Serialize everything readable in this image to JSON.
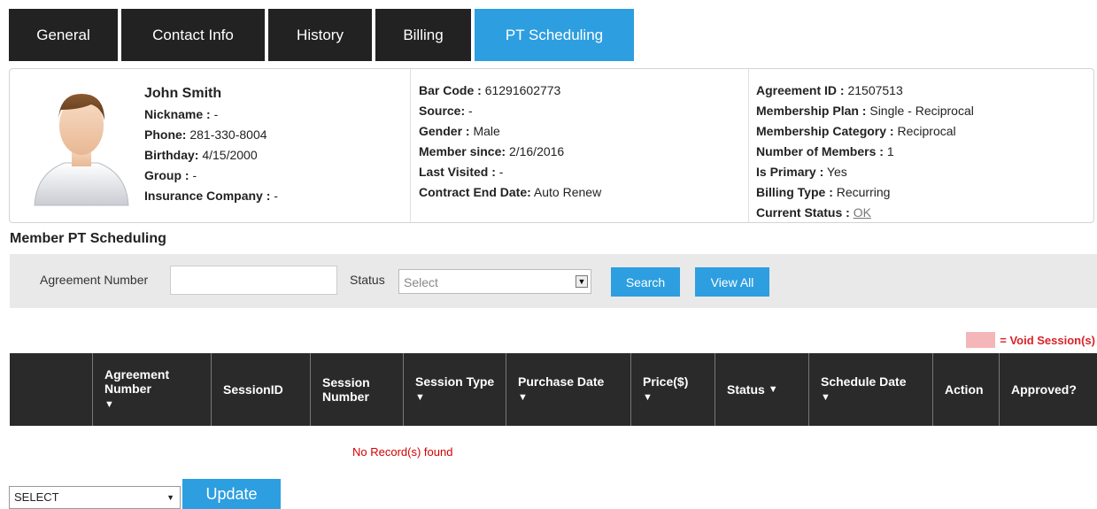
{
  "tabs": [
    {
      "label": "General",
      "active": false
    },
    {
      "label": "Contact Info",
      "active": false
    },
    {
      "label": "History",
      "active": false
    },
    {
      "label": "Billing",
      "active": false
    },
    {
      "label": "PT Scheduling",
      "active": true
    }
  ],
  "member": {
    "name": "John Smith",
    "nickname_label": "Nickname :",
    "nickname": "-",
    "phone_label": "Phone:",
    "phone": "281-330-8004",
    "birthday_label": "Birthday:",
    "birthday": "4/15/2000",
    "group_label": "Group :",
    "group": "-",
    "insurance_label": "Insurance Company :",
    "insurance": "-",
    "barcode_label": "Bar Code :",
    "barcode": "61291602773",
    "source_label": "Source:",
    "source": "-",
    "gender_label": "Gender :",
    "gender": "Male",
    "since_label": "Member since:",
    "since": "2/16/2016",
    "visited_label": "Last Visited :",
    "visited": "-",
    "contract_label": "Contract End Date:",
    "contract": "Auto Renew",
    "agreement_label": "Agreement ID :",
    "agreement": "21507513",
    "plan_label": "Membership Plan :",
    "plan": "Single - Reciprocal",
    "category_label": "Membership Category :",
    "category": "Reciprocal",
    "members_label": "Number of Members :",
    "members": "1",
    "primary_label": "Is Primary :",
    "primary": "Yes",
    "billing_label": "Billing Type :",
    "billing": "Recurring",
    "status_label": "Current Status :",
    "status": "OK"
  },
  "section_title": "Member PT Scheduling",
  "search": {
    "agreement_label": "Agreement Number",
    "agreement_value": "",
    "status_label": "Status",
    "status_value": "Select",
    "search_button": "Search",
    "view_all_button": "View All"
  },
  "legend": {
    "label": "= Void Session(s)",
    "color": "#f4b6b8"
  },
  "table": {
    "headers": [
      "",
      "Agreement Number",
      "SessionID",
      "Session Number",
      "Session Type",
      "Purchase Date",
      "Price($)",
      "Status",
      "Schedule Date",
      "Action",
      "Approved?"
    ],
    "empty_message": "No Record(s) found"
  },
  "bulk": {
    "select_value": "SELECT",
    "update_button": "Update"
  },
  "colors": {
    "accent": "#2d9ee0",
    "tab_bg": "#222222",
    "header_bg": "#2a2a2a",
    "error": "#d40000"
  }
}
